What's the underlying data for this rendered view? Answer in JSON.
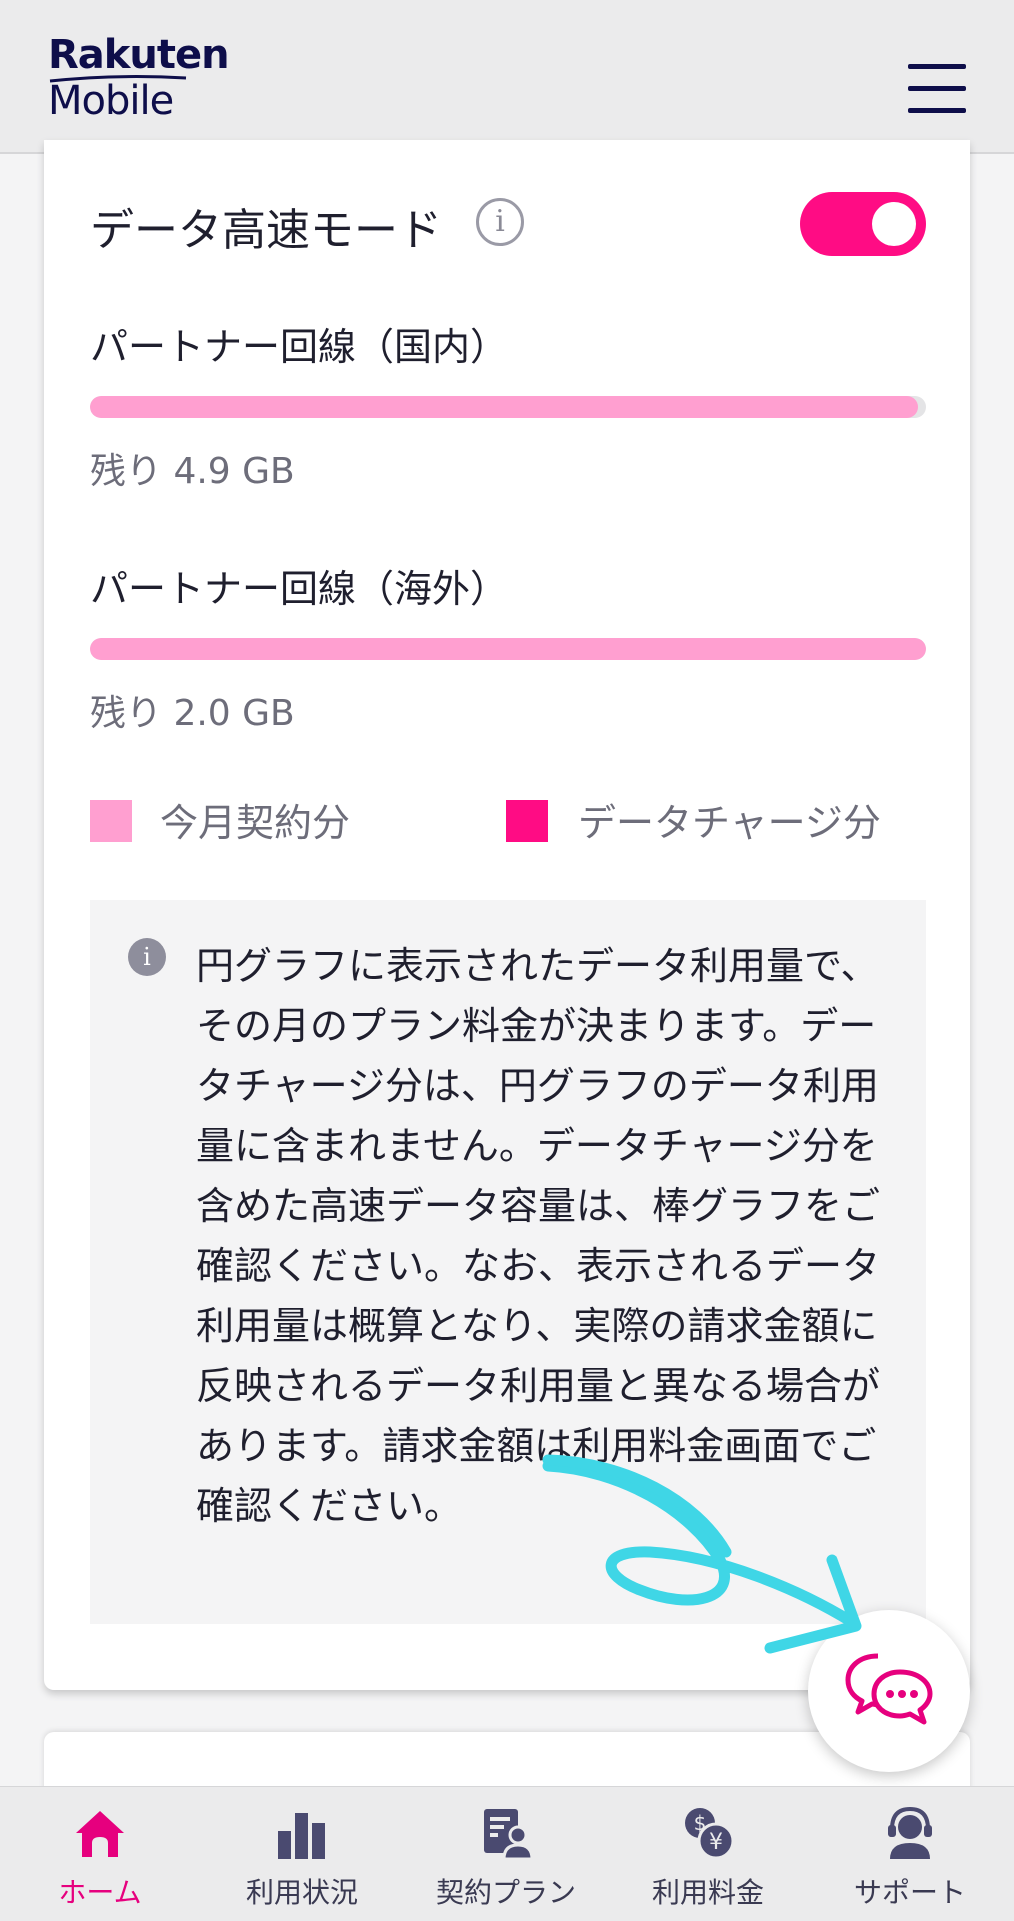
{
  "header": {
    "brand": "Rakuten",
    "product": "Mobile",
    "menu_icon": "hamburger-menu-icon"
  },
  "data_mode": {
    "title": "データ高速モード",
    "info_icon": "info-icon",
    "info_glyph": "i",
    "toggle_on": true
  },
  "lines": [
    {
      "title": "パートナー回線（国内）",
      "remaining": "残り 4.9 GB",
      "fill_percent": 99
    },
    {
      "title": "パートナー回線（海外）",
      "remaining": "残り 2.0 GB",
      "fill_percent": 100
    }
  ],
  "legend": [
    {
      "label": "今月契約分",
      "color": "#ff9fd0"
    },
    {
      "label": "データチャージ分",
      "color": "#ff0c84"
    }
  ],
  "note": {
    "icon_glyph": "i",
    "text": "円グラフに表示されたデータ利用量で、その月のプラン料金が決まります。データチャージ分は、円グラフのデータ利用量に含まれません。データチャージ分を含めた高速データ容量は、棒グラフをご確認ください。なお、表示されるデータ利用量は概算となり、実際の請求金額に反映されるデータ利用量と異なる場合があります。請求金額は利用料金画面でご確認ください。"
  },
  "chat": {
    "icon": "chat-bubbles-icon"
  },
  "nav": [
    {
      "label": "ホーム",
      "icon": "home-icon",
      "active": true
    },
    {
      "label": "利用状況",
      "icon": "bar-chart-icon",
      "active": false
    },
    {
      "label": "契約プラン",
      "icon": "contract-icon",
      "active": false
    },
    {
      "label": "利用料金",
      "icon": "yen-coins-icon",
      "active": false
    },
    {
      "label": "サポート",
      "icon": "support-headset-icon",
      "active": false
    }
  ],
  "colors": {
    "accent": "#ff0c84",
    "bar_light": "#ff9fd0",
    "navy": "#0e0e4a",
    "annotation_arrow": "#3fd6e6"
  }
}
